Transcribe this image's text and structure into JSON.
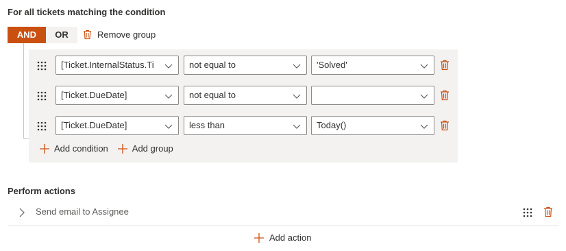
{
  "condition_section": {
    "title": "For all tickets matching the condition",
    "logic_toggle": {
      "and_label": "AND",
      "or_label": "OR",
      "selected": "AND"
    },
    "remove_group_label": "Remove group",
    "rows": [
      {
        "field": "[Ticket.InternalStatus.Tit...",
        "operator": "not equal to",
        "value": "'Solved'"
      },
      {
        "field": "[Ticket.DueDate]",
        "operator": "not equal to",
        "value": ""
      },
      {
        "field": "[Ticket.DueDate]",
        "operator": "less than",
        "value": "Today()"
      }
    ],
    "add_condition_label": "Add condition",
    "add_group_label": "Add group"
  },
  "actions_section": {
    "title": "Perform actions",
    "actions": [
      {
        "label": "Send email to Assignee"
      }
    ],
    "add_action_label": "Add action"
  },
  "colors": {
    "accent": "#ca5010",
    "group_bg": "#f3f2f1",
    "border": "#8a8886",
    "text": "#323130"
  },
  "icons": [
    "trash-icon",
    "grip-icon",
    "chevron-down-icon",
    "chevron-right-icon",
    "plus-icon"
  ]
}
